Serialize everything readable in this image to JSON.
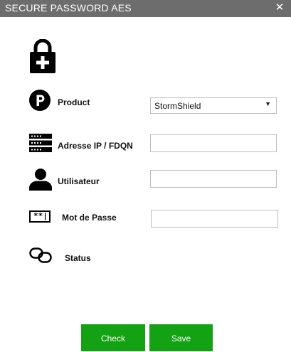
{
  "window": {
    "title": "SECURE PASSWORD AES",
    "close_glyph": "✕"
  },
  "icons": {
    "header": "lock-plus-icon",
    "product": "parking-p-icon",
    "address": "server-icon",
    "user": "user-icon",
    "password": "password-field-icon",
    "status": "link-icon"
  },
  "form": {
    "product": {
      "label": "Product",
      "selected": "StormShield",
      "caret": "▼"
    },
    "address": {
      "label": "Adresse IP / FDQN",
      "value": ""
    },
    "user": {
      "label": "Utilisateur",
      "value": ""
    },
    "password": {
      "label": "Mot de Passe",
      "value": "",
      "icon_text": "**|"
    },
    "status": {
      "label": "Status"
    }
  },
  "buttons": {
    "check": "Check",
    "save": "Save"
  },
  "colors": {
    "titlebar": "#6d6d6d",
    "button": "#13a213",
    "icon": "#000000"
  }
}
